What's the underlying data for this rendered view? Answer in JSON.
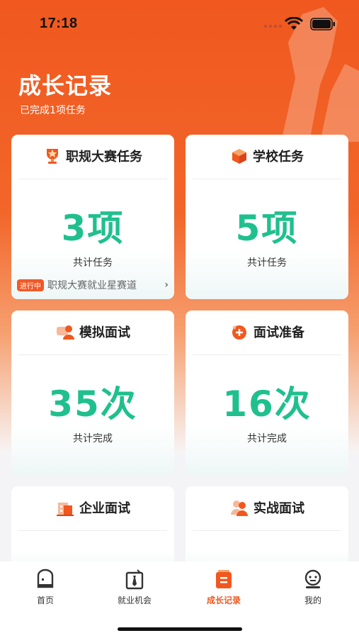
{
  "status_bar": {
    "time": "17:18"
  },
  "header": {
    "title": "成长记录",
    "subtitle": "已完成1项任务"
  },
  "cards": [
    {
      "title": "职规大赛任务",
      "icon": "trophy-icon",
      "value": "3项",
      "caption": "共计任务",
      "badge": "进行中",
      "footer_text": "职规大赛就业星赛道"
    },
    {
      "title": "学校任务",
      "icon": "box-icon",
      "value": "5项",
      "caption": "共计任务"
    },
    {
      "title": "模拟面试",
      "icon": "chat-person-icon",
      "value": "35次",
      "caption": "共计完成"
    },
    {
      "title": "面试准备",
      "icon": "prep-icon",
      "value": "16次",
      "caption": "共计完成"
    },
    {
      "title": "企业面试",
      "icon": "building-icon",
      "value": "",
      "caption": ""
    },
    {
      "title": "实战面试",
      "icon": "people-icon",
      "value": "",
      "caption": ""
    }
  ],
  "tabs": [
    {
      "label": "首页",
      "icon": "home-icon"
    },
    {
      "label": "就业机会",
      "icon": "tie-icon"
    },
    {
      "label": "成长记录",
      "icon": "record-icon",
      "active": true
    },
    {
      "label": "我的",
      "icon": "profile-icon"
    }
  ],
  "colors": {
    "accent": "#f0581f",
    "value_green": "#1fc08d"
  }
}
